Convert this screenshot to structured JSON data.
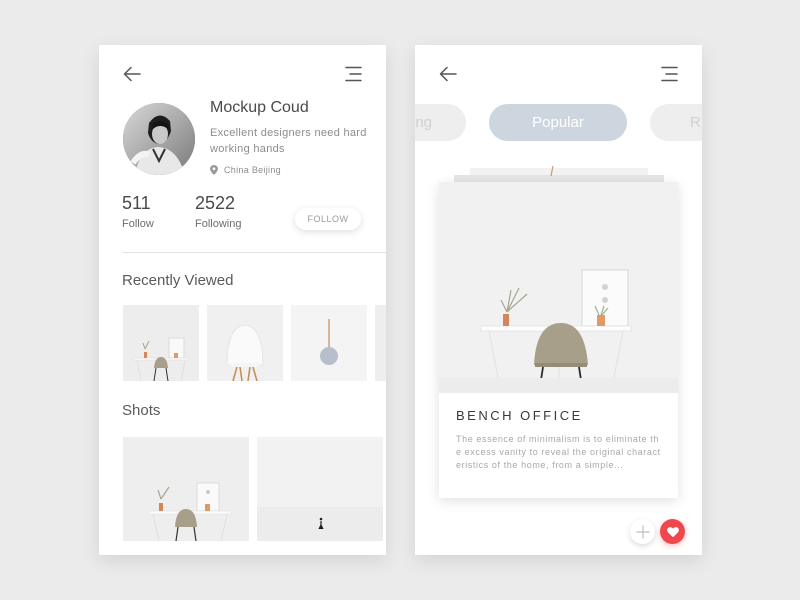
{
  "colors": {
    "accent_pill": "#cdd6de",
    "like": "#f0474c",
    "background": "#ebebeb"
  },
  "profile_screen": {
    "header": {
      "back_icon": "back-arrow-icon",
      "menu_icon": "menu-icon"
    },
    "profile": {
      "name": "Mockup Coud",
      "bio": "Excellent designers need hardworking hands",
      "location_icon": "location-pin-icon",
      "location": "China Beijing"
    },
    "stats": [
      {
        "value": "511",
        "label": "Follow"
      },
      {
        "value": "2522",
        "label": "Following"
      }
    ],
    "follow_button_label": "FOLLOW",
    "recently_viewed_title": "Recently Viewed",
    "shots_title": "Shots"
  },
  "detail_screen": {
    "header": {
      "back_icon": "back-arrow-icon",
      "menu_icon": "menu-icon"
    },
    "tabs": [
      {
        "label": "ng",
        "active": false
      },
      {
        "label": "Popular",
        "active": true
      },
      {
        "label": "R",
        "active": false
      }
    ],
    "card": {
      "title": "BENCH OFFICE",
      "description": "The essence of minimalism is to eliminate the excess vanity to reveal the original characteristics of the home, from a simple...",
      "add_icon": "plus-icon",
      "like_icon": "heart-icon"
    }
  }
}
